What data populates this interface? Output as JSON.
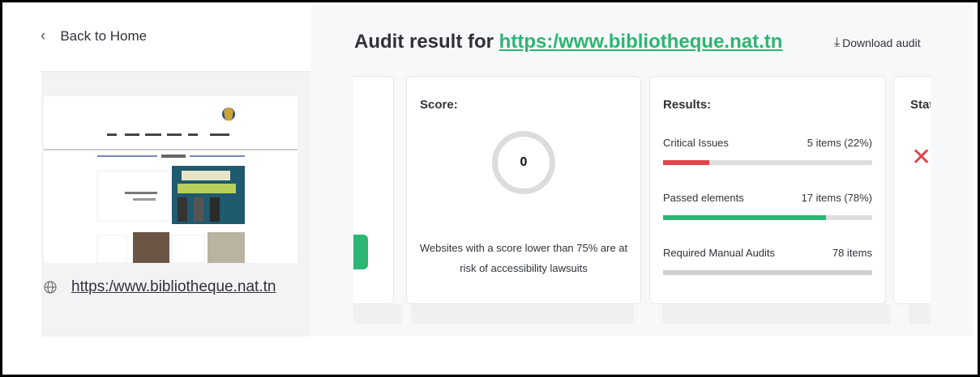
{
  "nav": {
    "back_label": "Back to Home"
  },
  "audit": {
    "title_prefix": "Audit result for",
    "url": "https:/www.bibliotheque.nat.tn",
    "download_label": "Download audit"
  },
  "sidebar": {
    "site_url": "https:/www.bibliotheque.nat.tn"
  },
  "score_card": {
    "title": "Score:",
    "score": "0",
    "note": "Websites with a score lower than 75% are at risk of accessibility lawsuits"
  },
  "results_card": {
    "title": "Results:",
    "rows": [
      {
        "label": "Critical Issues",
        "value": "5 items (22%)",
        "fraction": 0.22,
        "color": "#e0454b"
      },
      {
        "label": "Passed elements",
        "value": "17 items (78%)",
        "fraction": 0.78,
        "color": "#2bb673"
      },
      {
        "label": "Required Manual Audits",
        "value": "78 items",
        "fraction": 1.0,
        "color": "#cfcfcf"
      }
    ]
  },
  "status_card": {
    "title": "Statu",
    "icon": "x-mark-icon",
    "icon_color": "#e0454b"
  },
  "colors": {
    "accent": "#2bb673",
    "critical": "#e0454b"
  }
}
